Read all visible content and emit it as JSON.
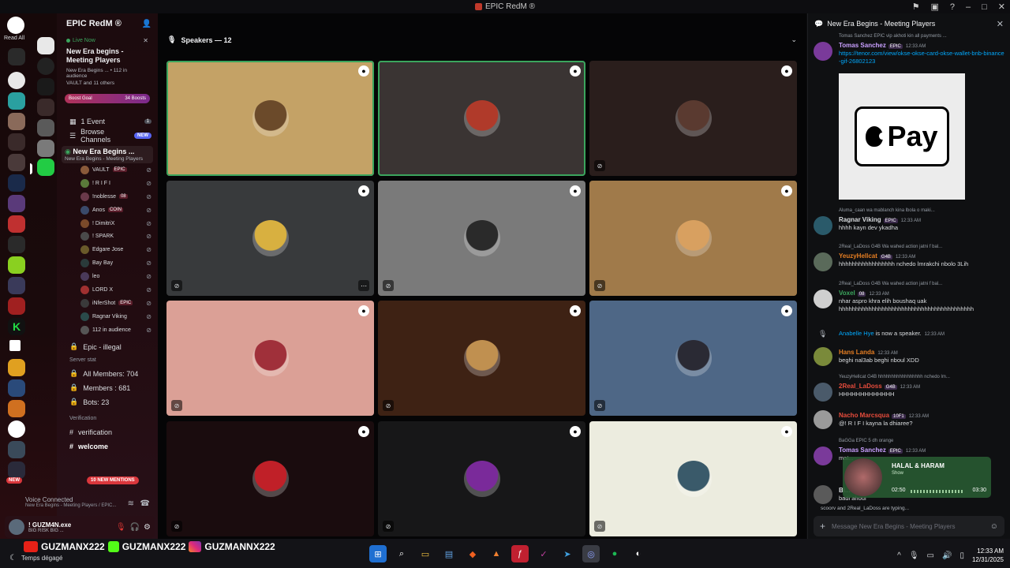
{
  "window": {
    "title": "EPIC RedM ®"
  },
  "rail": {
    "read_all": "Read All",
    "new_label": "NEW"
  },
  "server": {
    "name": "EPIC RedM ®",
    "live_now": "Live Now",
    "live_title": "New Era begins - Meeting Players",
    "live_sub": "New Era Begins ... • 112 in audience",
    "live_people": "VAULT and 11 others",
    "boost_goal": "Boost Goal",
    "boost_count": "34 Boosts",
    "event": "1 Event",
    "event_count": "1",
    "browse": "Browse Channels",
    "browse_tag": "NEW",
    "stage_channel": "New Era Begins ...",
    "stage_channel_sub": "New Era Begins - Meeting Players",
    "members": [
      {
        "name": "VAULT",
        "tag": "EPIC",
        "color": "#8a5a3a"
      },
      {
        "name": "! R I F I",
        "tag": "",
        "color": "#5a7a3a"
      },
      {
        "name": "!noblesse",
        "tag": "08",
        "color": "#6a3a4a"
      },
      {
        "name": "Anos",
        "tag": "COIN",
        "color": "#3a4a6a"
      },
      {
        "name": "! DimitriX",
        "tag": "",
        "color": "#7a4a2a"
      },
      {
        "name": "! SPARK",
        "tag": "",
        "color": "#4a4a4a"
      },
      {
        "name": "Edgare Jose",
        "tag": "",
        "color": "#6a5a2a"
      },
      {
        "name": "Bay Bay",
        "tag": "",
        "color": "#2a3a3a"
      },
      {
        "name": "leo",
        "tag": "",
        "color": "#4a3a5a"
      },
      {
        "name": "LORD X",
        "tag": "",
        "color": "#a03030"
      },
      {
        "name": "iNferShot",
        "tag": "EPIC",
        "color": "#3a3a3a"
      },
      {
        "name": "Ragnar Viking",
        "tag": "",
        "color": "#2a4a4a"
      },
      {
        "name": "112 in audience",
        "tag": "",
        "color": "#555555"
      }
    ],
    "category_channel": "Epic - illegal",
    "server_stat": "Server stat",
    "all_members": "All Members: 704",
    "members_count": "Members : 681",
    "bots": "Bots: 23",
    "verification_cat": "Verification",
    "verification": "verification",
    "welcome": "welcome",
    "new_mentions": "10 NEW MENTIONS"
  },
  "voice": {
    "status": "Voice Connected",
    "path": "New Era Begins - Meeting Players / EPIC..."
  },
  "user": {
    "name": "! GUZM4N.exe",
    "status": "BIG RISK BIG ..."
  },
  "stage": {
    "speakers_label": "Speakers — 12",
    "tiles": [
      {
        "bg": "#c4a266",
        "pfp": "#6b4a2a",
        "speaking": true,
        "muted": false
      },
      {
        "bg": "#3a3433",
        "pfp": "#b03a2a",
        "speaking": true,
        "muted": false
      },
      {
        "bg": "#2a1e1c",
        "pfp": "#5a3a30",
        "speaking": false,
        "muted": true
      },
      {
        "bg": "#383a3c",
        "pfp": "#d8b040",
        "speaking": false,
        "muted": true
      },
      {
        "bg": "#7a7a7a",
        "pfp": "#2a2a2a",
        "speaking": false,
        "muted": true
      },
      {
        "bg": "#a07a4a",
        "pfp": "#d8a060",
        "speaking": false,
        "muted": true
      },
      {
        "bg": "#dba096",
        "pfp": "#a0303a",
        "speaking": false,
        "muted": true
      },
      {
        "bg": "#3e2214",
        "pfp": "#c09050",
        "speaking": false,
        "muted": true
      },
      {
        "bg": "#4e6786",
        "pfp": "#2a2a34",
        "speaking": false,
        "muted": true
      },
      {
        "bg": "#1a0c0e",
        "pfp": "#c02028",
        "speaking": false,
        "muted": true
      },
      {
        "bg": "#171718",
        "pfp": "#7a2a9a",
        "speaking": false,
        "muted": true
      },
      {
        "bg": "#ececdf",
        "pfp": "#3a5a6a",
        "speaking": false,
        "muted": true
      }
    ]
  },
  "chat": {
    "title": "New Era Begins - Meeting Players",
    "messages": [
      {
        "reply": "Tomas Sanchez  EPIC  vip akhoti kin all payments ...",
        "author": "Tomas Sanchez",
        "author_color": "#c9a0ff",
        "tag": "EPIC",
        "time": "12:33 AM",
        "link": "https://tenor.com/view/okse-okse-card-okse-wallet-bnb-binance-gif-26802123",
        "text": "",
        "avatar": "#7a3a9a"
      },
      {
        "reply": "Aluma_caan  wa mablanch kina lbola o maki...",
        "author": "Ragnar Viking",
        "author_color": "#dbdee1",
        "tag": "EPIC",
        "time": "12:33 AM",
        "text": "hhhh kayn dev ykadha",
        "avatar": "#2a5a6a"
      },
      {
        "reply": "2Real_LaDoss  G4B  Wa wahed action jatni  f bal...",
        "author": "YeuzyHellcat",
        "author_color": "#e67e22",
        "tag": "G4B",
        "time": "12:33 AM",
        "text": "hhhhhhhhhhhhhhhhh nchedo lmrakchi nbolo 3Lih",
        "avatar": "#5a6a5a"
      },
      {
        "reply": "2Real_LaDoss  G4B  Wa wahed action jatni  f bal...",
        "author": "Voxel",
        "author_color": "#3ba55d",
        "tag": "08",
        "time": "12:33 AM",
        "text": "nhar aspro khra elih boushaq uak hhhhhhhhhhhhhhhhhhhhhhhhhhhhhhhhhhhhhhhhh",
        "avatar": "#cfcfcf"
      },
      {
        "system": "Anabelle Hye is now a speaker.",
        "system_name": "Anabelle Hye",
        "system_rest": "is now a speaker.",
        "time": "12:33 AM"
      },
      {
        "author": "Hans Landa",
        "author_color": "#e67e22",
        "time": "12:33 AM",
        "text": "beghi nal3ab beghi nboul XDD",
        "avatar": "#7a8a3a"
      },
      {
        "reply": "YeuzyHellcat  G4B  hhhhhhhhhhhhhhhhh nchedo lm...",
        "author": "2Real_LaDoss",
        "author_color": "#e74c3c",
        "tag": "G4B",
        "time": "12:33 AM",
        "text": "HHHHHHHHHHHHH",
        "avatar": "#4a5a6a"
      },
      {
        "author": "Nacho Marcsqua",
        "author_color": "#e74c3c",
        "tag": "10F1",
        "time": "12:33 AM",
        "text": "@! R I F I  kayna la dhiaree?",
        "avatar": "#9a9a9a"
      },
      {
        "reply": "BaGGa  EPIC  5 dh orange",
        "author": "Tomas Sanchez",
        "author_color": "#c9a0ff",
        "tag": "EPIC",
        "time": "12:33 AM",
        "text": "mat...",
        "avatar": "#7a3a9a"
      },
      {
        "author": "Bi...",
        "author_color": "#dbdee1",
        "time": "",
        "text": "badi ahoui",
        "avatar": "#5a5a5a"
      }
    ],
    "applepay_text": "Pay",
    "player": {
      "title": "HALAL & HARAM",
      "subtitle": "Show",
      "elapsed": "02:50",
      "total": "03:30"
    },
    "typing": "scoorv and 2Real_LaDoss are typing...",
    "input_placeholder": "Message New Era Begins - Meeting Players"
  },
  "overlay": {
    "youtube": "GUZMANX222",
    "kick": "GUZMANX222",
    "instagram": "GUZMANNX222"
  },
  "taskbar": {
    "weather": "Temps dégagé",
    "time": "12:33 AM",
    "date": "12/31/2025"
  }
}
